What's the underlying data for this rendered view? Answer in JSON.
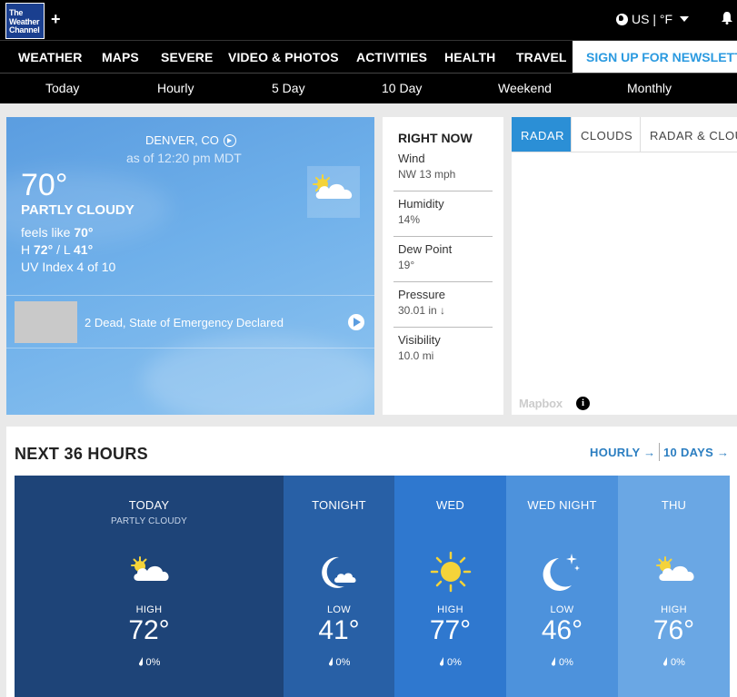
{
  "header": {
    "logo_lines": [
      "The",
      "Weather",
      "Channel"
    ],
    "add_symbol": "+",
    "locale": "US | °F",
    "bell_icon": "bell-icon",
    "globe_icon": "globe-icon"
  },
  "mainnav": {
    "items": [
      "WEATHER",
      "MAPS",
      "SEVERE",
      "VIDEO & PHOTOS",
      "ACTIVITIES",
      "HEALTH",
      "TRAVEL"
    ],
    "newsletter": "SIGN UP FOR NEWSLETTER"
  },
  "subnav": {
    "items": [
      "Today",
      "Hourly",
      "5 Day",
      "10 Day",
      "Weekend",
      "Monthly"
    ]
  },
  "current": {
    "location": "DENVER, CO",
    "as_of": "as of 12:20 pm MDT",
    "temp": "70°",
    "condition": "PARTLY CLOUDY",
    "feels_label": "feels like",
    "feels_value": "70°",
    "hl_prefix": "H",
    "high": "72°",
    "hl_sep": " / L",
    "low": "41°",
    "uv": "UV Index 4 of 10",
    "icon": "partly-cloudy-icon",
    "headline": "2 Dead, State of Emergency Declared"
  },
  "right_now": {
    "title": "RIGHT NOW",
    "rows": [
      {
        "label": "Wind",
        "value": "NW 13 mph"
      },
      {
        "label": "Humidity",
        "value": "14%"
      },
      {
        "label": "Dew Point",
        "value": "19°"
      },
      {
        "label": "Pressure",
        "value": "30.01 in ↓"
      },
      {
        "label": "Visibility",
        "value": "10.0 mi"
      }
    ]
  },
  "radar": {
    "tabs": [
      "RADAR",
      "CLOUDS",
      "RADAR & CLOUDS"
    ],
    "attribution": "Mapbox",
    "info_symbol": "i"
  },
  "next36": {
    "title": "NEXT 36 HOURS",
    "hourly_link": "HOURLY →",
    "tendays_link": "10 DAYS →",
    "periods": [
      {
        "name": "TODAY",
        "condition": "PARTLY CLOUDY",
        "label": "HIGH",
        "temp": "72°",
        "precip": "0%",
        "icon": "partly-cloudy-icon",
        "color": "#1e4478"
      },
      {
        "name": "TONIGHT",
        "condition": "",
        "label": "LOW",
        "temp": "41°",
        "precip": "0%",
        "icon": "moon-cloud-icon",
        "color": "#2860a6"
      },
      {
        "name": "WED",
        "condition": "",
        "label": "HIGH",
        "temp": "77°",
        "precip": "0%",
        "icon": "sun-icon",
        "color": "#2f78cf"
      },
      {
        "name": "WED NIGHT",
        "condition": "",
        "label": "LOW",
        "temp": "46°",
        "precip": "0%",
        "icon": "clear-night-icon",
        "color": "#4d92dc"
      },
      {
        "name": "THU",
        "condition": "",
        "label": "HIGH",
        "temp": "76°",
        "precip": "0%",
        "icon": "partly-cloudy-icon",
        "color": "#6aa7e4"
      }
    ]
  }
}
